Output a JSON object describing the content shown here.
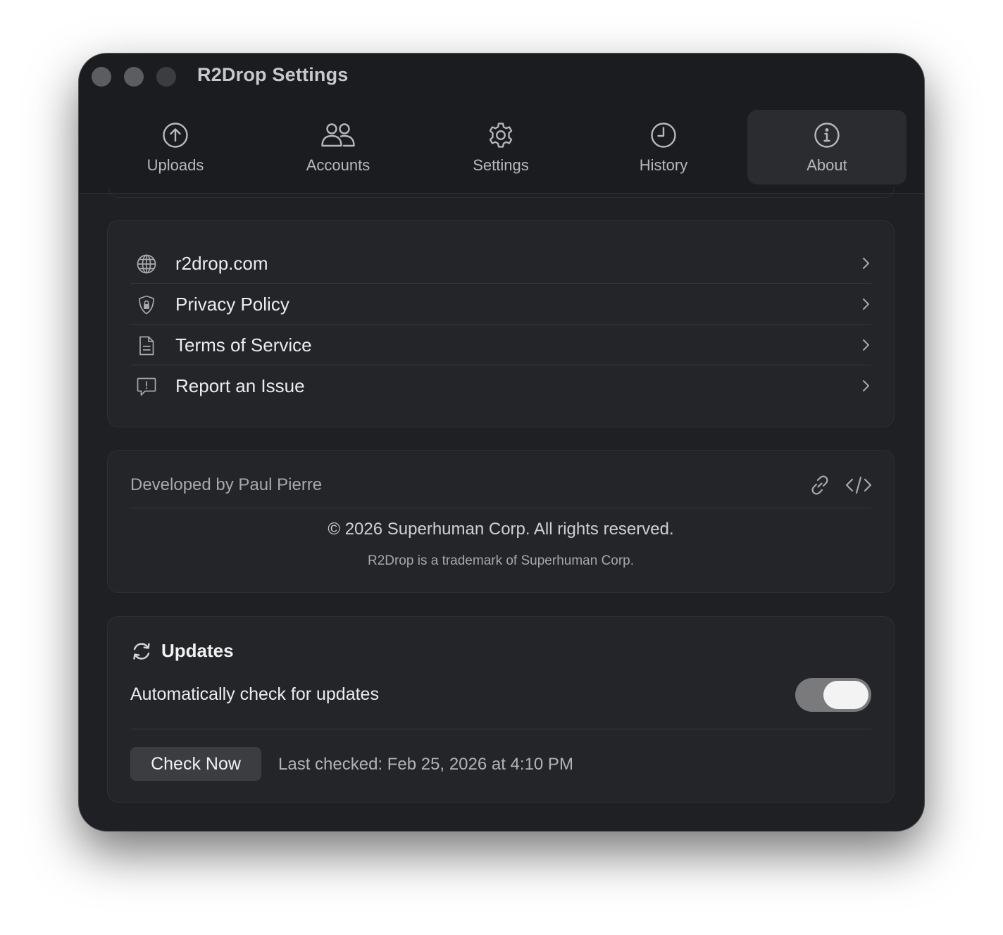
{
  "window": {
    "title": "R2Drop Settings"
  },
  "tabs": [
    {
      "label": "Uploads",
      "icon": "upload-circle-icon"
    },
    {
      "label": "Accounts",
      "icon": "people-icon"
    },
    {
      "label": "Settings",
      "icon": "gear-icon"
    },
    {
      "label": "History",
      "icon": "clock-icon"
    },
    {
      "label": "About",
      "icon": "info-icon",
      "active": true
    }
  ],
  "links": [
    {
      "label": "r2drop.com",
      "icon": "globe-icon"
    },
    {
      "label": "Privacy Policy",
      "icon": "shield-lock-icon"
    },
    {
      "label": "Terms of Service",
      "icon": "document-icon"
    },
    {
      "label": "Report an Issue",
      "icon": "exclamation-bubble-icon"
    }
  ],
  "about": {
    "developer": "Developed by Paul Pierre",
    "copyright": "© 2026 Superhuman Corp. All rights reserved.",
    "trademark": "R2Drop is a trademark of Superhuman Corp."
  },
  "updates": {
    "title": "Updates",
    "auto_label": "Automatically check for updates",
    "auto_enabled": true,
    "check_button": "Check Now",
    "last_checked": "Last checked: Feb 25, 2026 at 4:10 PM"
  },
  "colors": {
    "window_bg": "#1f2023",
    "card_bg": "#242528",
    "active_tab": "#2b2c2f",
    "toggle_track": "#7a7a7d"
  }
}
